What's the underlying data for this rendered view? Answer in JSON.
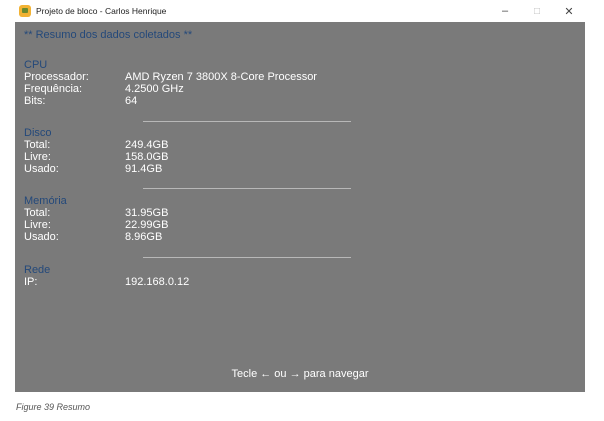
{
  "window": {
    "title": "Projeto de bloco - Carlos Henrique",
    "controls": {
      "minimize": "–",
      "maximize": "□",
      "close": "✕"
    }
  },
  "header": "** Resumo dos dados coletados **",
  "cpu": {
    "title": "CPU",
    "rows": [
      {
        "label": "Processador:",
        "value": "AMD Ryzen 7 3800X 8-Core Processor"
      },
      {
        "label": "Frequência:",
        "value": "4.2500 GHz"
      },
      {
        "label": "Bits:",
        "value": "64"
      }
    ]
  },
  "disco": {
    "title": "Disco",
    "rows": [
      {
        "label": "Total:",
        "value": "249.4GB"
      },
      {
        "label": "Livre:",
        "value": "158.0GB"
      },
      {
        "label": "Usado:",
        "value": "91.4GB"
      }
    ]
  },
  "memoria": {
    "title": "Memória",
    "rows": [
      {
        "label": "Total:",
        "value": "31.95GB"
      },
      {
        "label": "Livre:",
        "value": "22.99GB"
      },
      {
        "label": "Usado:",
        "value": "8.96GB"
      }
    ]
  },
  "rede": {
    "title": "Rede",
    "rows": [
      {
        "label": "IP:",
        "value": "192.168.0.12"
      }
    ]
  },
  "footer": "Tecle ← ou → para navegar",
  "caption": "Figure 39 Resumo",
  "colors": {
    "client_bg": "#7a7a7a",
    "section_title": "#24497a",
    "text": "#ffffff"
  },
  "icons": {
    "app": "python-icon"
  }
}
